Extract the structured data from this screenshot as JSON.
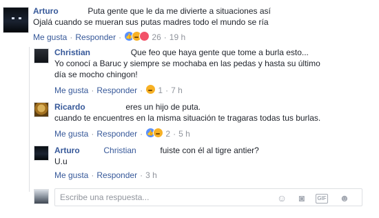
{
  "comments": [
    {
      "author": "Arturo",
      "text": "Puta gente que le da me divierte a situaciones así",
      "text2": "Ojalá cuando se mueran sus putas madres todo el mundo se ría",
      "like": "Me gusta",
      "reply": "Responder",
      "reactions": "26",
      "time": "19 h"
    },
    {
      "author": "Christian",
      "text": "Que feo que haya gente que tome a burla esto...",
      "text2": "Yo conocí a Baruc y siempre se mochaba en las pedas y hasta su último",
      "text3": "día se mocho chingon!",
      "like": "Me gusta",
      "reply": "Responder",
      "reactions": "1",
      "time": "7 h"
    },
    {
      "author": "Ricardo",
      "text": "eres un hijo de puta.",
      "text2": "cuando te encuentres en la misma situación te tragaras todas tus burlas.",
      "like": "Me gusta",
      "reply": "Responder",
      "reactions": "2",
      "time": "5 h"
    },
    {
      "author": "Arturo",
      "mention": "Christian",
      "text": "fuiste con él al tigre antier?",
      "text2": "U.u",
      "like": "Me gusta",
      "reply": "Responder",
      "time": "3 h"
    }
  ],
  "reply_box": {
    "placeholder": "Escribe una respuesta...",
    "icons": [
      "emoji-icon",
      "camera-icon",
      "gif-icon",
      "sticker-icon"
    ],
    "gif_label": "GIF"
  },
  "colors": {
    "link": "#365899",
    "meta": "#90949c",
    "like": "#5890ff",
    "haha": "#f7b125",
    "love": "#f25268"
  }
}
